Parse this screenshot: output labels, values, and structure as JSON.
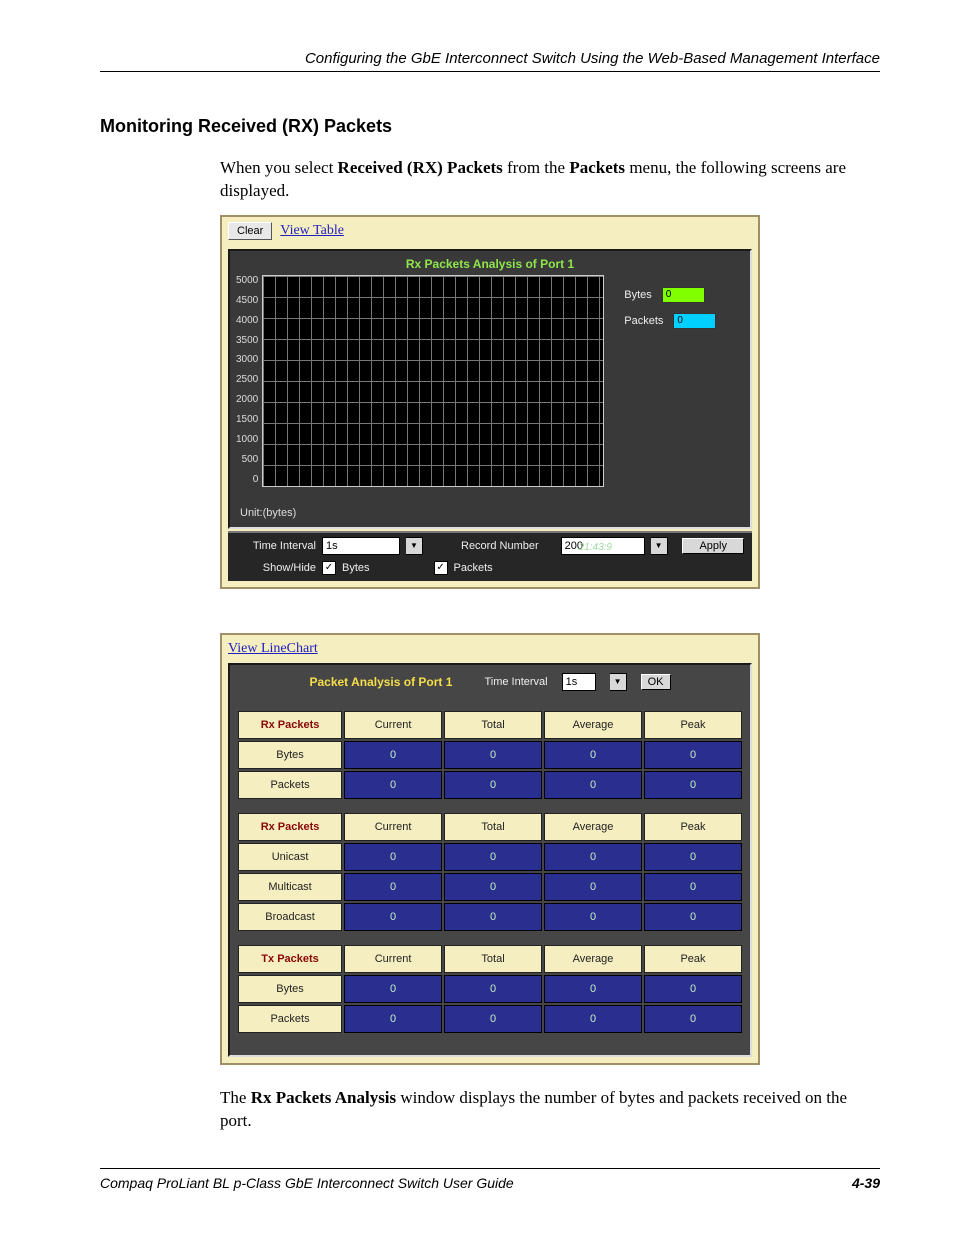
{
  "header": {
    "title": "Configuring the GbE Interconnect Switch Using the Web-Based Management Interface"
  },
  "section": {
    "heading": "Monitoring Received (RX) Packets"
  },
  "intro": {
    "pre": "When you select ",
    "bold1": "Received (RX) Packets",
    "mid": " from the ",
    "bold2": "Packets",
    "post": " menu, the following screens are displayed."
  },
  "screenshot1": {
    "clear_label": "Clear",
    "view_table_label": "View Table",
    "chart_title": "Rx Packets Analysis of Port 1",
    "legend": {
      "bytes_label": "Bytes",
      "bytes_value": "0",
      "packets_label": "Packets",
      "packets_value": "0"
    },
    "time_tick": "21:43:9",
    "unit_label": "Unit:(bytes)",
    "controls": {
      "time_interval_label": "Time Interval",
      "time_interval_value": "1s",
      "record_number_label": "Record Number",
      "record_number_value": "200",
      "apply_label": "Apply",
      "show_hide_label": "Show/Hide",
      "bytes_label": "Bytes",
      "packets_label": "Packets"
    }
  },
  "chart_data": {
    "type": "line",
    "title": "Rx Packets Analysis of Port 1",
    "xlabel": "",
    "ylabel": "",
    "ylim": [
      0,
      5000
    ],
    "y_ticks": [
      "5000",
      "4500",
      "4000",
      "3500",
      "3000",
      "2500",
      "2000",
      "1500",
      "1000",
      "500",
      "0"
    ],
    "series": [
      {
        "name": "Bytes",
        "values": [
          0
        ]
      },
      {
        "name": "Packets",
        "values": [
          0
        ]
      }
    ]
  },
  "screenshot2": {
    "view_linechart_label": "View LineChart",
    "title": "Packet Analysis of Port 1",
    "time_interval_label": "Time Interval",
    "time_interval_value": "1s",
    "ok_label": "OK",
    "columns": [
      "Current",
      "Total",
      "Average",
      "Peak"
    ],
    "groups": [
      {
        "header": "Rx Packets",
        "rows": [
          {
            "label": "Bytes",
            "values": [
              "0",
              "0",
              "0",
              "0"
            ]
          },
          {
            "label": "Packets",
            "values": [
              "0",
              "0",
              "0",
              "0"
            ]
          }
        ]
      },
      {
        "header": "Rx Packets",
        "rows": [
          {
            "label": "Unicast",
            "values": [
              "0",
              "0",
              "0",
              "0"
            ]
          },
          {
            "label": "Multicast",
            "values": [
              "0",
              "0",
              "0",
              "0"
            ]
          },
          {
            "label": "Broadcast",
            "values": [
              "0",
              "0",
              "0",
              "0"
            ]
          }
        ]
      },
      {
        "header": "Tx Packets",
        "rows": [
          {
            "label": "Bytes",
            "values": [
              "0",
              "0",
              "0",
              "0"
            ]
          },
          {
            "label": "Packets",
            "values": [
              "0",
              "0",
              "0",
              "0"
            ]
          }
        ]
      }
    ]
  },
  "outro": {
    "pre": "The ",
    "bold": "Rx Packets Analysis",
    "post": " window displays the number of bytes and packets received on the port."
  },
  "footer": {
    "left": "Compaq ProLiant BL p-Class GbE Interconnect Switch User Guide",
    "right": "4-39"
  }
}
